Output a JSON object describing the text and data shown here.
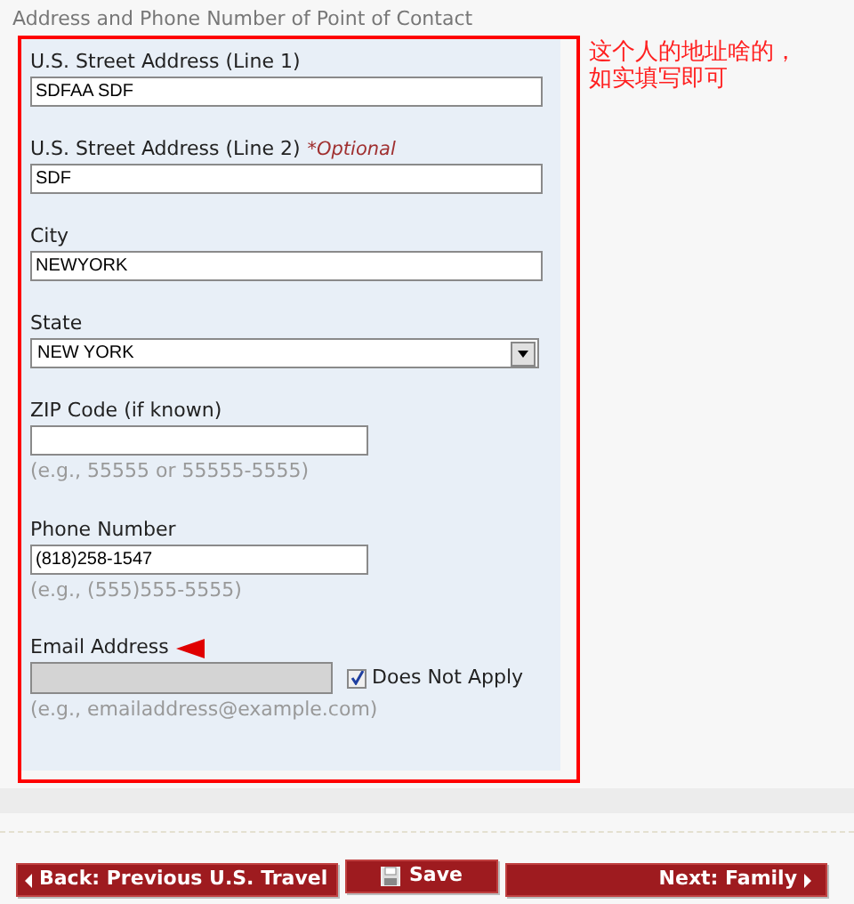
{
  "heading": "Address and Phone Number of Point of Contact",
  "annotation": [
    "这个人的地址啥的，",
    "如实填写即可"
  ],
  "fields": [
    {
      "kind": "text",
      "label": "U.S. Street Address (Line 1)",
      "value": "SDFAA SDF"
    },
    {
      "kind": "text",
      "label": "U.S. Street Address (Line 2)",
      "optional": "*Optional",
      "value": "SDF"
    },
    {
      "kind": "text",
      "label": "City",
      "value": "NEWYORK"
    },
    {
      "kind": "select",
      "label": "State",
      "value": "NEW YORK"
    },
    {
      "kind": "short",
      "label": "ZIP Code (if known)",
      "hint": "(e.g., 55555 or 55555-5555)"
    },
    {
      "kind": "short",
      "label": "Phone Number",
      "value": "(818)258-1547",
      "hint": "(e.g., (555)555-5555)"
    },
    {
      "kind": "email",
      "label": "Email Address",
      "disabled": true,
      "does_not_apply": {
        "label": "Does Not Apply",
        "checked": true
      },
      "hint": "(e.g., emailaddress@example.com)",
      "marked": true
    }
  ],
  "buttons": [
    {
      "kind": "back",
      "label": "Back: Previous U.S. Travel"
    },
    {
      "kind": "save",
      "label": "Save"
    },
    {
      "kind": "next",
      "label": "Next: Family"
    }
  ]
}
